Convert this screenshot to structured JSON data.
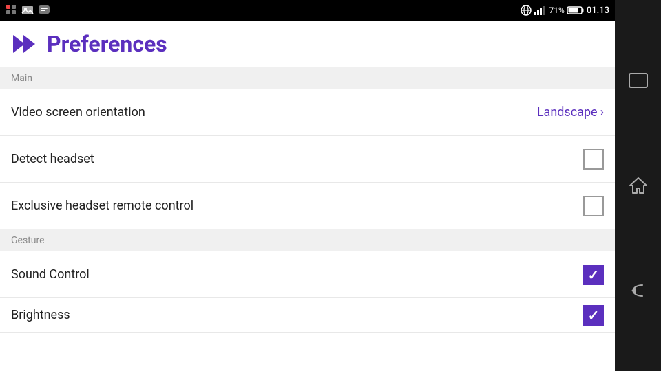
{
  "statusBar": {
    "batteryPercent": "71%",
    "time": "01.13",
    "signalStrength": 3,
    "apps": [
      "grid-icon",
      "image-icon",
      "bbm-icon"
    ]
  },
  "header": {
    "title": "Preferences",
    "icon": "skip-icon"
  },
  "sections": [
    {
      "label": "Main",
      "items": [
        {
          "label": "Video screen orientation",
          "type": "value",
          "value": "Landscape",
          "hasChevron": true
        },
        {
          "label": "Detect headset",
          "type": "checkbox",
          "checked": false
        },
        {
          "label": "Exclusive headset remote control",
          "type": "checkbox",
          "checked": false
        }
      ]
    },
    {
      "label": "Gesture",
      "items": [
        {
          "label": "Sound Control",
          "type": "checkbox",
          "checked": true
        },
        {
          "label": "Brightness",
          "type": "checkbox",
          "checked": true,
          "partial": true
        }
      ]
    }
  ],
  "sidebar": {
    "buttons": [
      {
        "icon": "recent-apps-icon",
        "shape": "rect-outline"
      },
      {
        "icon": "home-icon",
        "shape": "house"
      },
      {
        "icon": "back-icon",
        "shape": "arrow-back"
      }
    ]
  }
}
